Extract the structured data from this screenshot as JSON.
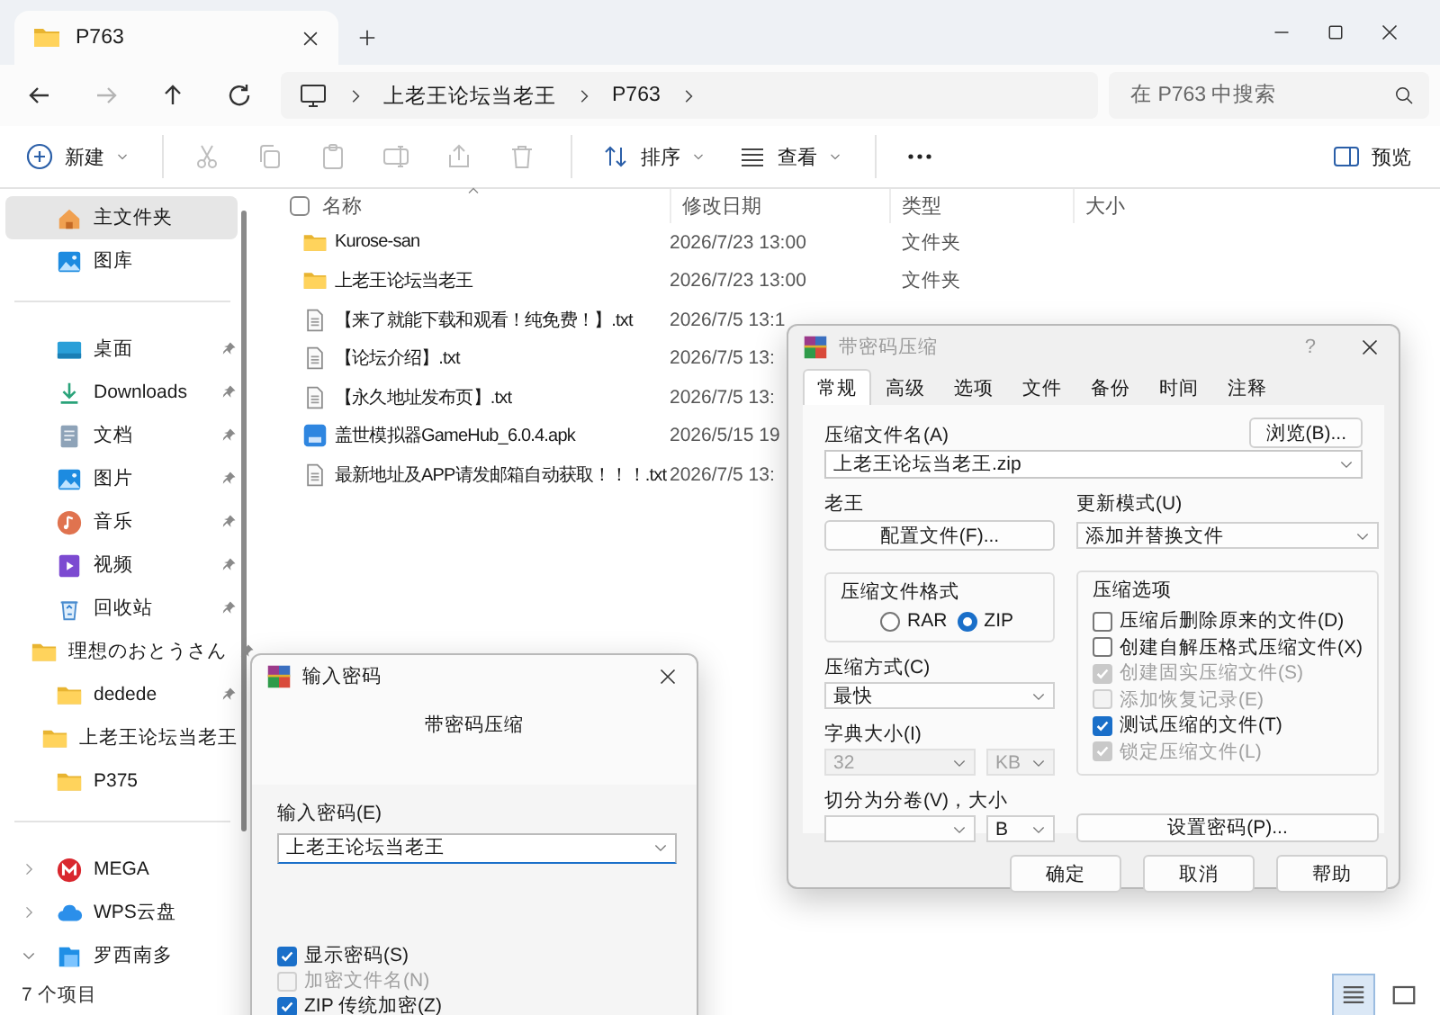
{
  "explorer": {
    "tab": {
      "title": "P763"
    },
    "nav": [
      {
        "kind": "back",
        "disabled": false
      },
      {
        "kind": "forward",
        "disabled": true
      },
      {
        "kind": "up",
        "disabled": false
      },
      {
        "kind": "refresh",
        "disabled": false
      }
    ],
    "breadcrumb": [
      "上老王论坛当老王",
      "P763"
    ],
    "search": {
      "placeholder": "在 P763 中搜索"
    },
    "toolbar": [
      {
        "kind": "new",
        "label": "新建",
        "disabled": false
      },
      {
        "kind": "cut",
        "disabled": true
      },
      {
        "kind": "copy",
        "disabled": true
      },
      {
        "kind": "paste",
        "disabled": true
      },
      {
        "kind": "rename",
        "disabled": true
      },
      {
        "kind": "share",
        "disabled": true
      },
      {
        "kind": "delete",
        "disabled": true
      },
      {
        "kind": "sort",
        "label": "排序",
        "disabled": false
      },
      {
        "kind": "view",
        "label": "查看",
        "disabled": false
      },
      {
        "kind": "more",
        "disabled": false
      }
    ],
    "preview": {
      "label": "预览"
    },
    "sidebar": [
      [
        {
          "label": "主文件夹",
          "kind": "home",
          "pinned": false,
          "selected": true
        },
        {
          "label": "图库",
          "kind": "gallery",
          "pinned": false,
          "selected": false
        }
      ],
      [
        {
          "label": "桌面",
          "kind": "desktop",
          "pinned": true,
          "selected": false
        },
        {
          "label": "Downloads",
          "kind": "download",
          "pinned": true,
          "selected": false
        },
        {
          "label": "文档",
          "kind": "document",
          "pinned": true,
          "selected": false
        },
        {
          "label": "图片",
          "kind": "picture",
          "pinned": true,
          "selected": false
        },
        {
          "label": "音乐",
          "kind": "music",
          "pinned": true,
          "selected": false
        },
        {
          "label": "视频",
          "kind": "video",
          "pinned": true,
          "selected": false
        },
        {
          "label": "回收站",
          "kind": "recycle",
          "pinned": true,
          "selected": false
        },
        {
          "label": "理想のおとうさん",
          "kind": "folder",
          "pinned": true,
          "selected": false
        },
        {
          "label": "dedede",
          "kind": "folder",
          "pinned": true,
          "selected": false
        },
        {
          "label": "上老王论坛当老王",
          "kind": "folder",
          "pinned": false,
          "selected": false
        },
        {
          "label": "P375",
          "kind": "folder",
          "pinned": false,
          "selected": false
        }
      ],
      [
        {
          "label": "MEGA",
          "kind": "mega",
          "pinned": false,
          "selected": false,
          "expanded": false
        },
        {
          "label": "WPS云盘",
          "kind": "cloud",
          "pinned": false,
          "selected": false,
          "expanded": false
        },
        {
          "label": "罗西南多",
          "kind": "drive",
          "pinned": false,
          "selected": false,
          "expanded": true
        }
      ]
    ],
    "header_checkbox": {
      "checked": false
    },
    "columns": [
      "名称",
      "修改日期",
      "类型",
      "大小"
    ],
    "rows": [
      {
        "kind": "folder",
        "name": "Kurose-san",
        "date": "2026/7/23 13:00",
        "type": "文件夹"
      },
      {
        "kind": "folder",
        "name": "上老王论坛当老王",
        "date": "2026/7/23 13:00",
        "type": "文件夹"
      },
      {
        "kind": "text",
        "name": "【来了就能下载和观看！纯免费！】.txt",
        "date": "2026/7/5 13:1"
      },
      {
        "kind": "text",
        "name": "【论坛介绍】.txt",
        "date": "2026/7/5 13:"
      },
      {
        "kind": "text",
        "name": "【永久地址发布页】.txt",
        "date": "2026/7/5 13:"
      },
      {
        "kind": "apk",
        "name": "盖世模拟器GameHub_6.0.4.apk",
        "date": "2026/5/15 19"
      },
      {
        "kind": "text",
        "name": "最新地址及APP请发邮箱自动获取！！！.txt",
        "date": "2026/7/5 13:"
      }
    ],
    "status": "7 个项目",
    "view_modes": [
      {
        "kind": "details",
        "selected": true
      },
      {
        "kind": "tiles",
        "selected": false
      }
    ]
  },
  "archive_dialog": {
    "title": "带密码压缩",
    "help": "?",
    "tabs": [
      {
        "label": "常规",
        "selected": true
      },
      {
        "label": "高级",
        "selected": false
      },
      {
        "label": "选项",
        "selected": false
      },
      {
        "label": "文件",
        "selected": false
      },
      {
        "label": "备份",
        "selected": false
      },
      {
        "label": "时间",
        "selected": false
      },
      {
        "label": "注释",
        "selected": false
      }
    ],
    "archive_name_label": "压缩文件名(A)",
    "browse_button": "浏览(B)...",
    "archive_name": "上老王论坛当老王.zip",
    "profile_label": "老王",
    "profile_button": "配置文件(F)...",
    "update_mode_label": "更新模式(U)",
    "update_mode": "添加并替换文件",
    "format_group": {
      "title": "压缩文件格式",
      "options": [
        {
          "label": "RAR",
          "selected": false
        },
        {
          "label": "ZIP",
          "selected": true
        }
      ]
    },
    "method_label": "压缩方式(C)",
    "method": "最快",
    "dictionary_label": "字典大小(I)",
    "dictionary_size": {
      "value": "32",
      "disabled": true
    },
    "dictionary_unit": {
      "value": "KB",
      "disabled": true
    },
    "split_label": "切分为分卷(V)，大小",
    "split_unit": {
      "value": "B",
      "disabled": false
    },
    "options_group": {
      "title": "压缩选项",
      "items": [
        {
          "label": "压缩后删除原来的文件(D)",
          "checked": false,
          "disabled": false
        },
        {
          "label": "创建自解压格式压缩文件(X)",
          "checked": false,
          "disabled": false
        },
        {
          "label": "创建固实压缩文件(S)",
          "checked": true,
          "disabled": true
        },
        {
          "label": "添加恢复记录(E)",
          "checked": false,
          "disabled": true
        },
        {
          "label": "测试压缩的文件(T)",
          "checked": true,
          "disabled": false
        },
        {
          "label": "锁定压缩文件(L)",
          "checked": true,
          "disabled": true
        }
      ]
    },
    "password_button": "设置密码(P)...",
    "buttons": [
      "确定",
      "取消",
      "帮助"
    ]
  },
  "password_dialog": {
    "title": "输入密码",
    "heading": "带密码压缩",
    "password_label": "输入密码(E)",
    "password": "上老王论坛当老王",
    "options": [
      {
        "label": "显示密码(S)",
        "checked": true,
        "disabled": false
      },
      {
        "label": "加密文件名(N)",
        "checked": false,
        "disabled": true
      },
      {
        "label": "ZIP 传统加密(Z)",
        "checked": true,
        "disabled": false
      }
    ]
  }
}
